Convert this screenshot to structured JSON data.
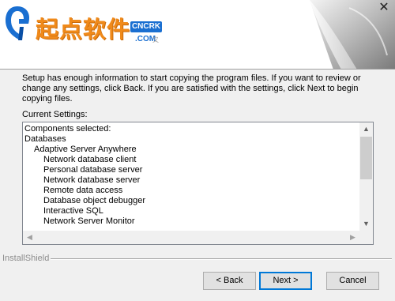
{
  "banner": {
    "logo_text": "起点软件",
    "logo_badge": "CNCRK",
    "logo_com": ".COM",
    "logo_sub": "又",
    "close_glyph": "✕"
  },
  "description": "Setup has enough information to start copying the program files.  If you want to review or change any settings, click Back.  If you are satisfied with the settings, click Next to begin copying files.",
  "settings_label": "Current Settings:",
  "settings_lines": [
    {
      "text": "Components selected:",
      "level": 0
    },
    {
      "text": "Databases",
      "level": 0
    },
    {
      "text": "Adaptive Server Anywhere",
      "level": 1
    },
    {
      "text": "Network database client",
      "level": 2
    },
    {
      "text": "Personal database server",
      "level": 2
    },
    {
      "text": "Network database server",
      "level": 2
    },
    {
      "text": "Remote data access",
      "level": 2
    },
    {
      "text": "Database object debugger",
      "level": 2
    },
    {
      "text": "Interactive SQL",
      "level": 2
    },
    {
      "text": "Network Server Monitor",
      "level": 2
    }
  ],
  "scroll": {
    "up": "▲",
    "down": "▼",
    "left": "◀",
    "right": "▶"
  },
  "footer": {
    "brand": "InstallShield",
    "back_label": "< Back",
    "next_label": "Next >",
    "cancel_label": "Cancel"
  },
  "colors": {
    "logo_orange": "#f08a1a",
    "logo_blue": "#1a6fd1",
    "default_button_border": "#0078d7"
  }
}
